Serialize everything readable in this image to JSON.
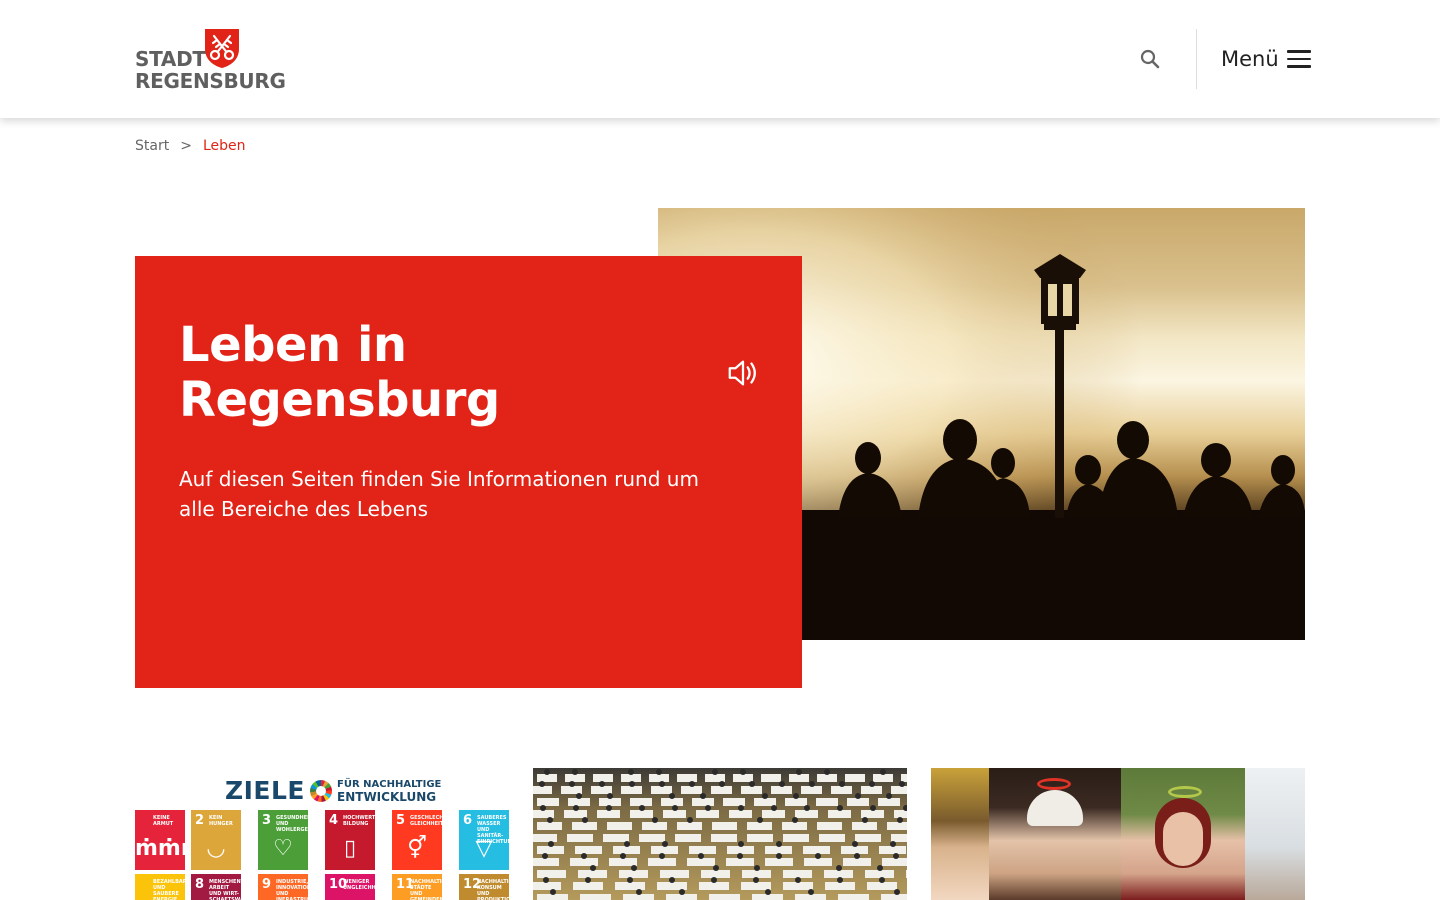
{
  "header": {
    "logo": {
      "line1": "STADT",
      "line2": "REGENSBURG",
      "crest": "keys-crest-icon"
    },
    "search_icon": "search-icon",
    "menu_label": "Menü",
    "menu_icon": "hamburger-icon"
  },
  "breadcrumb": {
    "items": [
      "Start",
      "Leben"
    ],
    "separator": ">"
  },
  "hero": {
    "title": "Leben in Regensburg",
    "read_aloud_icon": "speaker-icon",
    "text": "Auf diesen Seiten finden Sie Informationen rund um alle Bereiche des Lebens",
    "image": "Silhouetten von Menschen und Laterne im Gegenlicht"
  },
  "cards": [
    {
      "image_heading": "ZIELE",
      "image_subheading": [
        "FÜR NACHHALTIGE",
        "ENTWICKLUNG"
      ],
      "tiles": [
        {
          "num": "",
          "label": "KEINE ARMUT",
          "color": "#e5243b",
          "symbol": "ṁṁṁ"
        },
        {
          "num": "2",
          "label": "KEIN HUNGER",
          "color": "#dda63a",
          "symbol": "◡"
        },
        {
          "num": "3",
          "label": "GESUNDHEIT UND WOHLERGEHEN",
          "color": "#4c9f38",
          "symbol": "♡"
        },
        {
          "num": "4",
          "label": "HOCHWERTIGE BILDUNG",
          "color": "#c5192d",
          "symbol": "▯"
        },
        {
          "num": "5",
          "label": "GESCHLECHTER-GLEICHHEIT",
          "color": "#ff3a21",
          "symbol": "⚥"
        },
        {
          "num": "6",
          "label": "SAUBERES WASSER UND SANITÄR-EINRICHTUNGEN",
          "color": "#26bde2",
          "symbol": "▽"
        },
        {
          "num": "",
          "label": "BEZAHLBARE UND SAUBERE ENERGIE",
          "color": "#fcc30b",
          "symbol": ""
        },
        {
          "num": "8",
          "label": "MENSCHENWÜRDIGE ARBEIT UND WIRT-SCHAFTSWACHSTUM",
          "color": "#a21942",
          "symbol": ""
        },
        {
          "num": "9",
          "label": "INDUSTRIE, INNOVATION UND INFRASTRUKTUR",
          "color": "#fd6925",
          "symbol": ""
        },
        {
          "num": "10",
          "label": "WENIGER UNGLEICHHEITEN",
          "color": "#dd1367",
          "symbol": ""
        },
        {
          "num": "11",
          "label": "NACHHALTIGE STÄDTE UND GEMEINDEN",
          "color": "#fd9d24",
          "symbol": ""
        },
        {
          "num": "12",
          "label": "NACHHALTIGE/R KONSUM UND PRODUKTION",
          "color": "#bf8b2e",
          "symbol": ""
        }
      ]
    },
    {
      "image": "Prüfungssaal mit Tischreihen"
    },
    {
      "image": "Porträts mit Heiligenscheinen"
    }
  ],
  "colors": {
    "accent": "#e12417",
    "text": "#333333",
    "sdg_blue": "#19486a"
  }
}
